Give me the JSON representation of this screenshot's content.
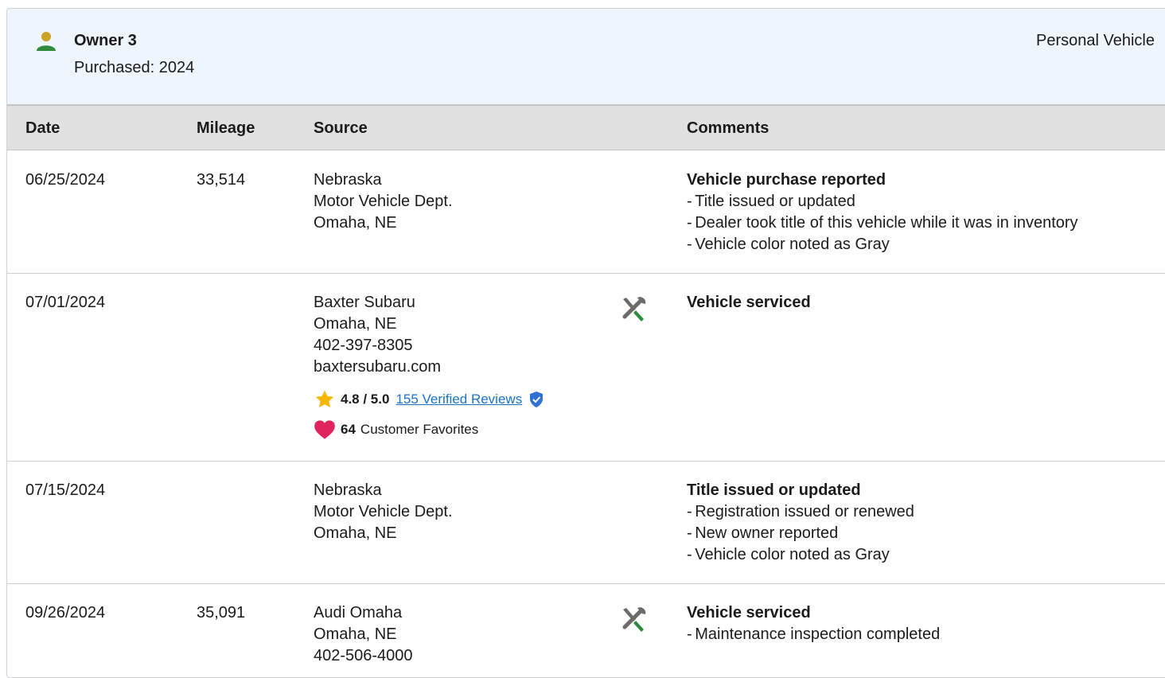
{
  "owner": {
    "name": "Owner 3",
    "purchased": "Purchased: 2024",
    "type": "Personal Vehicle"
  },
  "table": {
    "headers": {
      "date": "Date",
      "mileage": "Mileage",
      "source": "Source",
      "comments": "Comments"
    },
    "rows": [
      {
        "date": "06/25/2024",
        "mileage": "33,514",
        "source": [
          "Nebraska",
          "Motor Vehicle Dept.",
          "Omaha, NE"
        ],
        "icon": "",
        "comment_title": "Vehicle purchase reported",
        "comment_items": [
          "Title issued or updated",
          "Dealer took title of this vehicle while it was in inventory",
          "Vehicle color noted as Gray"
        ]
      },
      {
        "date": "07/01/2024",
        "mileage": "",
        "source": [
          "Baxter Subaru",
          "Omaha, NE",
          "402-397-8305",
          "baxtersubaru.com"
        ],
        "icon": "service-wrench-icon",
        "rating": "4.8 / 5.0",
        "reviews": "155 Verified Reviews",
        "favorites_count": "64",
        "favorites_label": "Customer Favorites",
        "comment_title": "Vehicle serviced",
        "comment_items": []
      },
      {
        "date": "07/15/2024",
        "mileage": "",
        "source": [
          "Nebraska",
          "Motor Vehicle Dept.",
          "Omaha, NE"
        ],
        "icon": "",
        "comment_title": "Title issued or updated",
        "comment_items": [
          "Registration issued or renewed",
          "New owner reported",
          "Vehicle color noted as Gray"
        ]
      },
      {
        "date": "09/26/2024",
        "mileage": "35,091",
        "source": [
          "Audi Omaha",
          "Omaha, NE",
          "402-506-4000"
        ],
        "icon": "service-wrench-icon",
        "comment_title": "Vehicle serviced",
        "comment_items": [
          "Maintenance inspection completed"
        ]
      }
    ]
  },
  "colors": {
    "header_bg": "#eef5fb",
    "table_header_bg": "#e1e1e1",
    "owner_icon_head": "#c9a227",
    "owner_icon_body": "#2e8b3e",
    "star": "#f5b800",
    "heart": "#e0245e",
    "link": "#1a73c9",
    "verified": "#2f6fd6",
    "wrench_gray": "#6b6b6b",
    "wrench_green": "#2e8b3e"
  }
}
